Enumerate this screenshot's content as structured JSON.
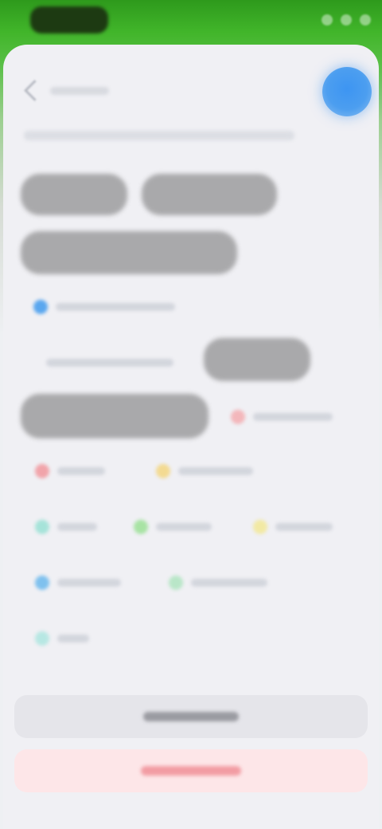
{
  "status_bar": {
    "time": "",
    "icons": [
      "signal-icon",
      "wifi-icon",
      "battery-icon"
    ]
  },
  "header": {
    "back_label": "",
    "profile_icon": "profile-icon",
    "subtitle": ""
  },
  "pills": [
    "",
    "",
    "",
    "",
    ""
  ],
  "chips": [
    {
      "label": "",
      "color": "#5aa7ef"
    },
    {
      "label": "",
      "color": "#f3b7bb"
    },
    {
      "label": "",
      "color": "#f1a4aa"
    },
    {
      "label": "",
      "color": "#f3da92"
    },
    {
      "label": "",
      "color": "#a6e3d9"
    },
    {
      "label": "",
      "color": "#a8e3a4"
    },
    {
      "label": "",
      "color": "#f2e9a4"
    },
    {
      "label": "",
      "color": "#7fc1ee"
    },
    {
      "label": "",
      "color": "#b9e6c8"
    },
    {
      "label": "",
      "color": "#b7e7e3"
    }
  ],
  "inline_text": "",
  "buttons": {
    "primary_label": "",
    "destructive_label": ""
  },
  "colors": {
    "accent_blue": "#4c9ef0",
    "header_green": "#41b52a",
    "pill_gray": "#a9a9ab",
    "destructive_tint": "#fde6e8"
  }
}
